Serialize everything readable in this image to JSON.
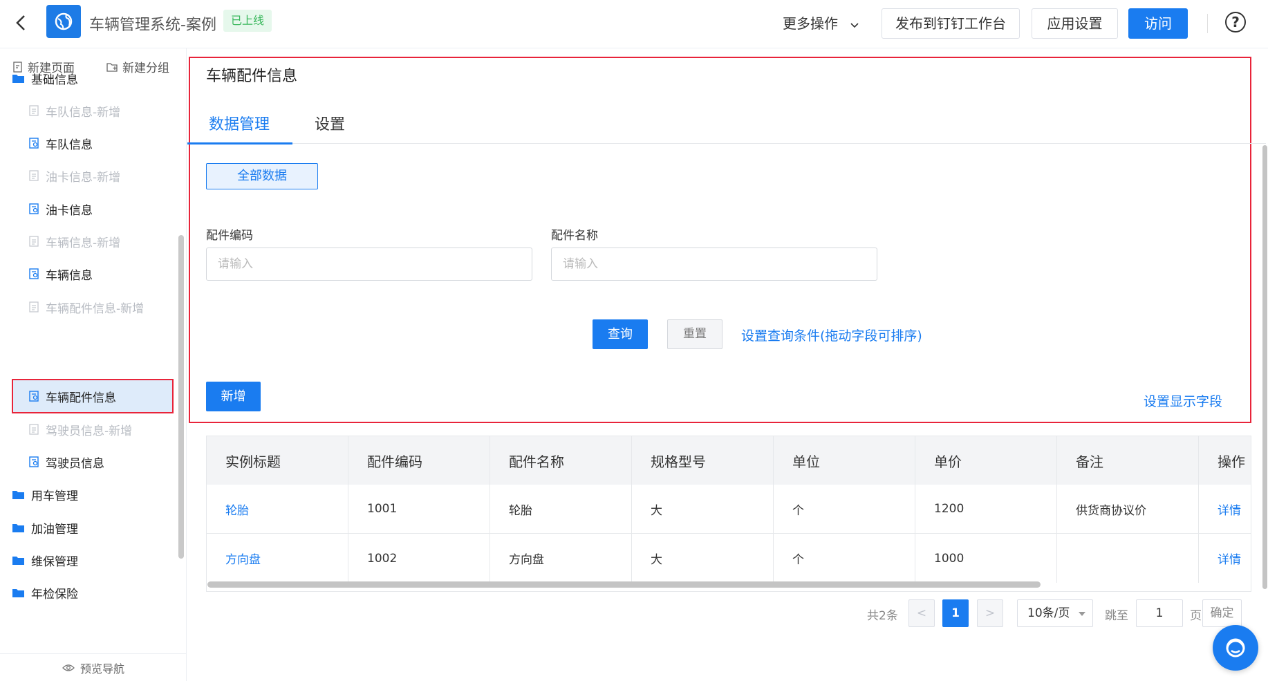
{
  "header": {
    "app_title": "车辆管理系统-案例",
    "status_badge": "已上线",
    "more_label": "更多操作",
    "publish_label": "发布到钉钉工作台",
    "settings_label": "应用设置",
    "visit_label": "访问",
    "help_icon": "?"
  },
  "sidebar": {
    "new_page": "新建页面",
    "new_group": "新建分组",
    "groups": [
      {
        "label": "基础信息"
      },
      {
        "label": "用车管理"
      },
      {
        "label": "加油管理"
      },
      {
        "label": "维保管理"
      },
      {
        "label": "年检保险"
      }
    ],
    "items": [
      {
        "label": "车队信息-新增"
      },
      {
        "label": "车队信息"
      },
      {
        "label": "油卡信息-新增"
      },
      {
        "label": "油卡信息"
      },
      {
        "label": "车辆信息-新增"
      },
      {
        "label": "车辆信息"
      },
      {
        "label": "车辆配件信息-新增"
      },
      {
        "label": "车辆配件信息"
      },
      {
        "label": "驾驶员信息-新增"
      },
      {
        "label": "驾驶员信息"
      }
    ],
    "footer": "预览导航"
  },
  "page": {
    "title": "车辆配件信息",
    "tabs": [
      "数据管理",
      "设置"
    ],
    "view_button": "全部数据",
    "fields": [
      {
        "label": "配件编码",
        "placeholder": "请输入"
      },
      {
        "label": "配件名称",
        "placeholder": "请输入"
      }
    ],
    "query_label": "查询",
    "reset_label": "重置",
    "query_settings_link": "设置查询条件(拖动字段可排序)",
    "new_label": "新增",
    "display_fields_link": "设置显示字段"
  },
  "table": {
    "columns": [
      "实例标题",
      "配件编码",
      "配件名称",
      "规格型号",
      "单位",
      "单价",
      "备注",
      "操作"
    ],
    "rows": [
      [
        "轮胎",
        "1001",
        "轮胎",
        "大",
        "个",
        "1200",
        "供货商协议价",
        "详情"
      ],
      [
        "方向盘",
        "1002",
        "方向盘",
        "大",
        "个",
        "1000",
        "",
        "详情"
      ]
    ]
  },
  "pagination": {
    "total": "共2条",
    "prev": "<",
    "current": "1",
    "next": ">",
    "page_size": "10条/页",
    "jump_label": "跳至",
    "jump_value": "1",
    "page_unit": "页",
    "confirm": "确定"
  },
  "colors": {
    "primary": "#1a7cf0",
    "highlight": "#e8243a",
    "success": "#38b75b"
  }
}
